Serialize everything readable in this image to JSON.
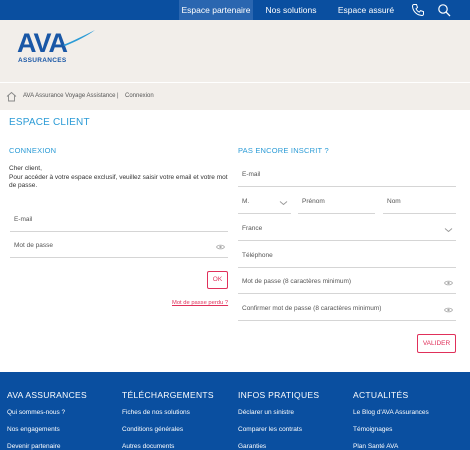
{
  "topnav": {
    "partner": "Espace partenaire",
    "solutions": "Nos solutions",
    "insured": "Espace assuré"
  },
  "logo": {
    "brand": "AVA",
    "sub": "ASSURANCES"
  },
  "breadcrumb": {
    "home_icon": "home-icon",
    "item1": "AVA Assurance Voyage Assistance",
    "sep": "|",
    "item2": "Connexion"
  },
  "page": {
    "title": "ESPACE CLIENT"
  },
  "login": {
    "heading": "CONNEXION",
    "text": "Cher client,\nPour accéder à votre espace exclusif, veuillez saisir votre email et votre mot de passe.",
    "email_label": "E-mail",
    "password_label": "Mot de passe",
    "ok_button": "OK",
    "forgot_link": "Mot de passe perdu ?"
  },
  "register": {
    "heading": "PAS ENCORE INSCRIT ?",
    "email_label": "E-mail",
    "civility": "M.",
    "firstname_label": "Prénom",
    "lastname_label": "Nom",
    "country": "France",
    "phone_label": "Téléphone",
    "password_label": "Mot de passe (8 caractères minimum)",
    "confirm_label": "Confirmer mot de passe (8 caractères minimum)",
    "submit_button": "VALIDER"
  },
  "footer": {
    "col1": {
      "heading": "AVA ASSURANCES",
      "links": [
        "Qui sommes-nous ?",
        "Nos engagements",
        "Devenir partenaire"
      ]
    },
    "col2": {
      "heading": "TÉLÉCHARGEMENTS",
      "links": [
        "Fiches de nos solutions",
        "Conditions générales",
        "Autres documents"
      ]
    },
    "col3": {
      "heading": "INFOS PRATIQUES",
      "links": [
        "Déclarer un sinistre",
        "Comparer les contrats",
        "Garanties"
      ]
    },
    "col4": {
      "heading": "ACTUALITÉS",
      "links": [
        "Le Blog d'AVA Assurances",
        "Témoignages",
        "Plan Santé AVA"
      ]
    }
  },
  "colors": {
    "nav_blue": "#0a4fa0",
    "accent_blue": "#2b9bd6",
    "accent_pink": "#e0305a",
    "header_bg": "#f2eeea"
  }
}
